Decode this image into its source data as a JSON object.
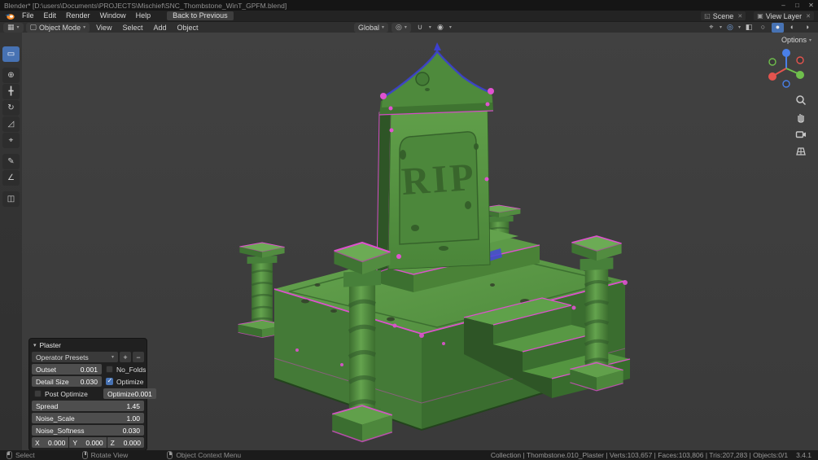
{
  "colors": {
    "accent": "#4772b3",
    "model_green": "#55923f",
    "edge_magenta": "#de52ce",
    "axis_x": "#e5544e",
    "axis_y": "#6fbf4c",
    "axis_z": "#4a80e8"
  },
  "window": {
    "title": "Blender* [D:\\users\\Documents\\PROJECTS\\Mischief\\SNC_Thombstone_WinT_GPFM.blend]",
    "minimize": "–",
    "maximize": "□",
    "close": "✕"
  },
  "menubar": {
    "menus": [
      "File",
      "Edit",
      "Render",
      "Window",
      "Help"
    ],
    "back_button": "Back to Previous",
    "scene_label": "Scene",
    "view_layer_label": "View Layer",
    "unlink": "✕"
  },
  "tool_header": {
    "mode": "Object Mode",
    "menus": [
      "View",
      "Select",
      "Add",
      "Object"
    ],
    "orientation": "Global",
    "options_label": "Options"
  },
  "icons": {
    "editor_type": "▦",
    "mode_cube": "▢",
    "dropdown": "▾",
    "pivot": "◎",
    "snap_magnet": "∪",
    "proportional": "◉",
    "gizmos": "⌖",
    "overlays": "◎",
    "xray": "◧",
    "wireframe": "○",
    "solid": "●",
    "material": "◐",
    "rendered": "◑",
    "tool_select": "▭",
    "tool_cursor": "⊕",
    "tool_move": "╋",
    "tool_rotate": "↻",
    "tool_scale": "◿",
    "tool_transform": "⌖",
    "tool_annotate": "✎",
    "tool_measure": "∠",
    "tool_cube": "◫",
    "scene": "◱",
    "view_layer": "▣"
  },
  "viewport": {
    "object_text": "RIP"
  },
  "operator_panel": {
    "title": "Plaster",
    "presets_label": "Operator Presets",
    "add_label": "+",
    "remove_label": "−",
    "outset": {
      "label": "Outset",
      "value": "0.001"
    },
    "no_folds": {
      "label": "No_Folds",
      "checked": false
    },
    "detail_size": {
      "label": "Detail Size",
      "value": "0.030"
    },
    "optimize": {
      "label": "Optimize",
      "checked": true
    },
    "post_optimize": {
      "label": "Post Optimize",
      "checked": false
    },
    "optimize2": {
      "label": "Optimize",
      "value": "0.001"
    },
    "spread": {
      "label": "Spread",
      "value": "1.45"
    },
    "noise_scale": {
      "label": "Noise_Scale",
      "value": "1.00"
    },
    "noise_softness": {
      "label": "Noise_Softness",
      "value": "0.030"
    },
    "x": {
      "label": "X",
      "value": "0.000"
    },
    "y": {
      "label": "Y",
      "value": "0.000"
    },
    "z": {
      "label": "Z",
      "value": "0.000"
    }
  },
  "statusbar": {
    "select": "Select",
    "rotate_view": "Rotate View",
    "context_menu": "Object Context Menu",
    "stats": "Collection | Thombstone.010_Plaster | Verts:103,657 | Faces:103,806 | Tris:207,283 | Objects:0/1",
    "version": "3.4.1"
  }
}
